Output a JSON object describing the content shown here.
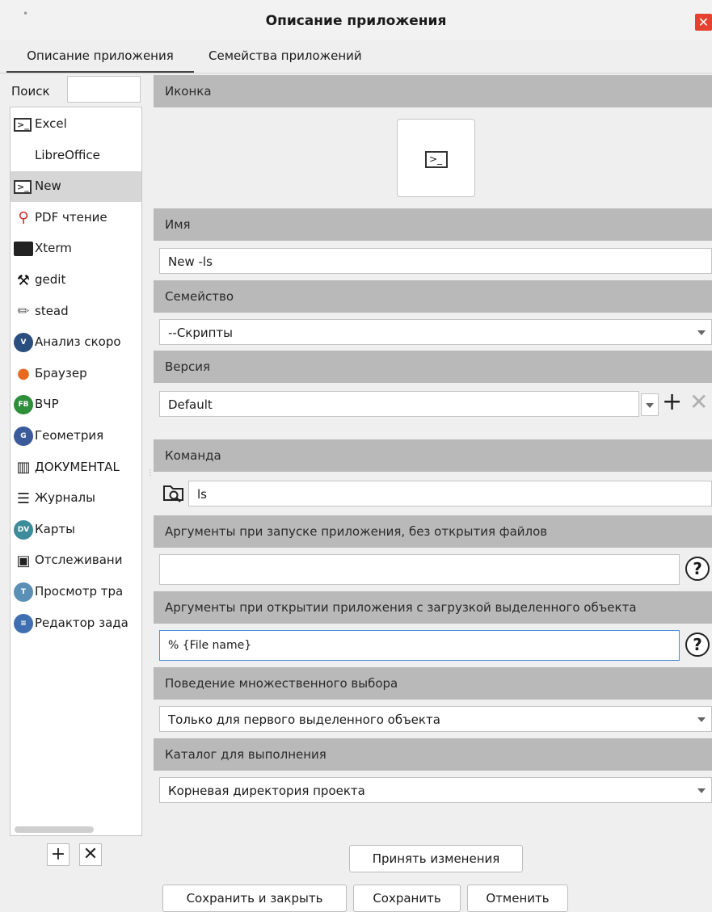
{
  "window": {
    "title": "Описание приложения",
    "close_glyph": "✕"
  },
  "tabs": [
    {
      "label": "Описание приложения",
      "active": true
    },
    {
      "label": "Семейства приложений",
      "active": false
    }
  ],
  "sidebar": {
    "search_label": "Поиск",
    "search_value": "",
    "items": [
      {
        "label": "Excel",
        "icon": "terminal-icon",
        "color": "#ffffff"
      },
      {
        "label": "LibreOffice",
        "icon": "edit-script-icon",
        "color": "#ffffff"
      },
      {
        "label": "New",
        "icon": "terminal-icon",
        "color": "#ffffff",
        "selected": true
      },
      {
        "label": "PDF чтение",
        "icon": "pdf-icon",
        "color": "#d22a2a"
      },
      {
        "label": "Xterm",
        "icon": "xterm-icon",
        "color": "#222222"
      },
      {
        "label": "gedit",
        "icon": "hammer-icon",
        "color": "#111111"
      },
      {
        "label": "stead",
        "icon": "pencil-icon",
        "color": "#666666"
      },
      {
        "label": "Анализ скоро",
        "icon": "v-badge-icon",
        "color": "#2a4e7e",
        "badge": "V"
      },
      {
        "label": "Браузер",
        "icon": "firefox-icon",
        "color": "#e86a1f"
      },
      {
        "label": "ВЧР",
        "icon": "fb-badge-icon",
        "color": "#2d8f3a",
        "badge": "FB"
      },
      {
        "label": "Геометрия",
        "icon": "g-badge-icon",
        "color": "#3a5a9c",
        "badge": "G"
      },
      {
        "label": "ДОКУМЕНТАL",
        "icon": "book-icon",
        "color": "#222222"
      },
      {
        "label": "Журналы",
        "icon": "list-icon",
        "color": "#222222"
      },
      {
        "label": "Карты",
        "icon": "dv-badge-icon",
        "color": "#3d8c9a",
        "badge": "DV"
      },
      {
        "label": "Отслеживани",
        "icon": "monitor-icon",
        "color": "#222222"
      },
      {
        "label": "Просмотр тра",
        "icon": "t-badge-icon",
        "color": "#5a8fb6",
        "badge": "T"
      },
      {
        "label": "Редактор зада",
        "icon": "editor-badge-icon",
        "color": "#3f6fb0",
        "badge": "≡"
      }
    ],
    "add_glyph": "+",
    "delete_glyph": "✕"
  },
  "form": {
    "icon_section": "Иконка",
    "name_section": "Имя",
    "name_value": "New -ls",
    "family_section": "Семейство",
    "family_value": "--Скрипты",
    "version_section": "Версия",
    "version_value": "Default",
    "version_add": "+",
    "version_delete": "✕",
    "command_section": "Команда",
    "command_value": "ls",
    "args_no_files_section": "Аргументы при запуске приложения, без открытия файлов",
    "args_no_files_value": "",
    "args_with_object_section": "Аргументы при открытии приложения с загрузкой выделенного объекта",
    "args_with_object_value": "% {File name}",
    "help_glyph": "?",
    "multi_select_section": "Поведение множественного выбора",
    "multi_select_value": "Только для первого выделенного объекта",
    "workdir_section": "Каталог для выполнения",
    "workdir_value": "Корневая директория проекта"
  },
  "buttons": {
    "accept": "Принять изменения",
    "save_close": "Сохранить и закрыть",
    "save": "Сохранить",
    "cancel": "Отменить"
  }
}
